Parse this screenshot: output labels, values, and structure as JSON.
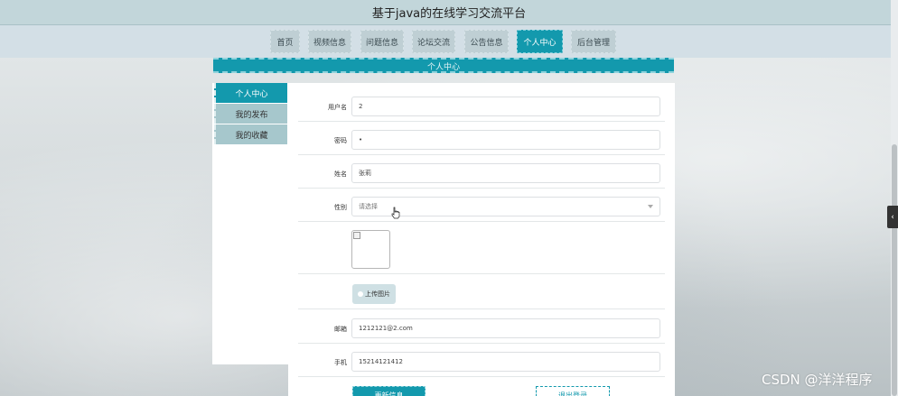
{
  "header": {
    "title": "基于java的在线学习交流平台"
  },
  "nav": {
    "items": [
      {
        "label": "首页",
        "active": false
      },
      {
        "label": "视频信息",
        "active": false
      },
      {
        "label": "问题信息",
        "active": false
      },
      {
        "label": "论坛交流",
        "active": false
      },
      {
        "label": "公告信息",
        "active": false
      },
      {
        "label": "个人中心",
        "active": true
      },
      {
        "label": "后台管理",
        "active": false
      }
    ]
  },
  "banner": {
    "title": "个人中心"
  },
  "sidebar": {
    "items": [
      {
        "label": "个人中心",
        "active": true
      },
      {
        "label": "我的发布",
        "active": false
      },
      {
        "label": "我的收藏",
        "active": false
      }
    ]
  },
  "form": {
    "username": {
      "label": "用户名",
      "value": "2"
    },
    "password": {
      "label": "密码",
      "value": "•"
    },
    "name": {
      "label": "姓名",
      "value": "张莉"
    },
    "gender": {
      "label": "性别",
      "placeholder": "请选择"
    },
    "upload": {
      "label": "上传图片"
    },
    "email": {
      "label": "邮箱",
      "value": "1212121@2.com"
    },
    "phone": {
      "label": "手机",
      "value": "15214121412"
    }
  },
  "actions": {
    "update": "更新信息",
    "logout": "退出登录"
  },
  "watermark": "CSDN @洋洋程序",
  "colors": {
    "accent": "#1399ad",
    "header": "#c2d6da",
    "nav": "#d3dfe6"
  }
}
